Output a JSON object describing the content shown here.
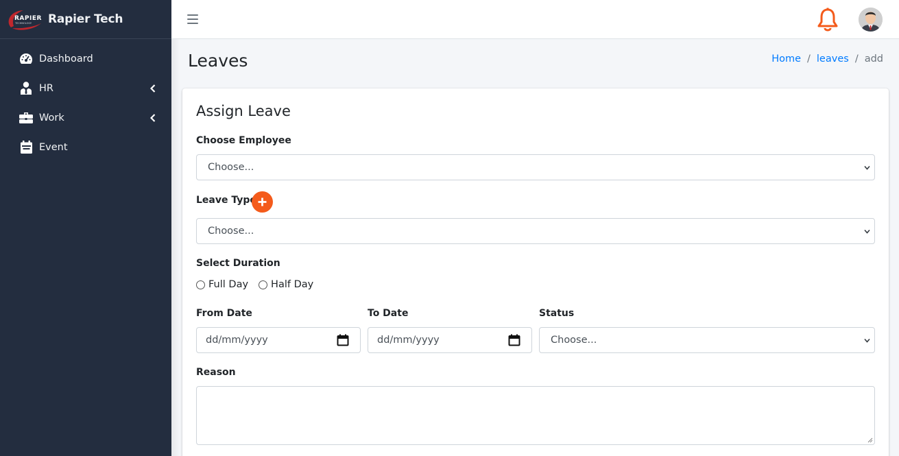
{
  "brand": {
    "name": "Rapier Tech",
    "logo_text": "RAPIER"
  },
  "sidebar": {
    "items": [
      {
        "label": "Dashboard",
        "icon": "speedometer-icon",
        "has_children": false
      },
      {
        "label": "HR",
        "icon": "user-tie-icon",
        "has_children": true
      },
      {
        "label": "Work",
        "icon": "briefcase-icon",
        "has_children": true
      },
      {
        "label": "Event",
        "icon": "calendar-icon",
        "has_children": false
      }
    ]
  },
  "topbar": {
    "menu_icon": "hamburger-icon",
    "notification_icon": "bell-icon",
    "avatar_icon": "user-avatar"
  },
  "page": {
    "title": "Leaves",
    "breadcrumb": {
      "home": "Home",
      "section": "leaves",
      "current": "add"
    }
  },
  "form": {
    "title": "Assign Leave",
    "employee": {
      "label": "Choose Employee",
      "value": "Choose..."
    },
    "leave_type": {
      "label": "Leave Type",
      "value": "Choose..."
    },
    "duration": {
      "label": "Select Duration",
      "options": [
        "Full Day",
        "Half Day"
      ]
    },
    "from_date": {
      "label": "From Date",
      "placeholder": "dd/mm/yyyy"
    },
    "to_date": {
      "label": "To Date",
      "placeholder": "dd/mm/yyyy"
    },
    "status": {
      "label": "Status",
      "value": "Choose..."
    },
    "reason": {
      "label": "Reason",
      "value": ""
    }
  },
  "colors": {
    "sidebar_bg": "#232d3f",
    "accent": "#f45b1b",
    "link": "#007bff"
  }
}
